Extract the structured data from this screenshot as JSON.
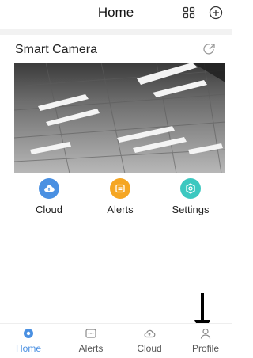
{
  "header": {
    "title": "Home"
  },
  "device": {
    "name": "Smart Camera"
  },
  "actions": [
    {
      "label": "Cloud",
      "icon": "cloud-icon",
      "color": "#4a90e2"
    },
    {
      "label": "Alerts",
      "icon": "alerts-icon",
      "color": "#f5a623"
    },
    {
      "label": "Settings",
      "icon": "settings-icon",
      "color": "#3cc8c0"
    }
  ],
  "bottom_nav": {
    "active": "Home",
    "items": [
      {
        "label": "Home",
        "icon": "home-icon"
      },
      {
        "label": "Alerts",
        "icon": "alerts-icon"
      },
      {
        "label": "Cloud",
        "icon": "cloud-icon"
      },
      {
        "label": "Profile",
        "icon": "profile-icon"
      }
    ]
  },
  "colors": {
    "accent": "#4a90e2",
    "alerts": "#f5a623",
    "settings": "#3cc8c0"
  }
}
